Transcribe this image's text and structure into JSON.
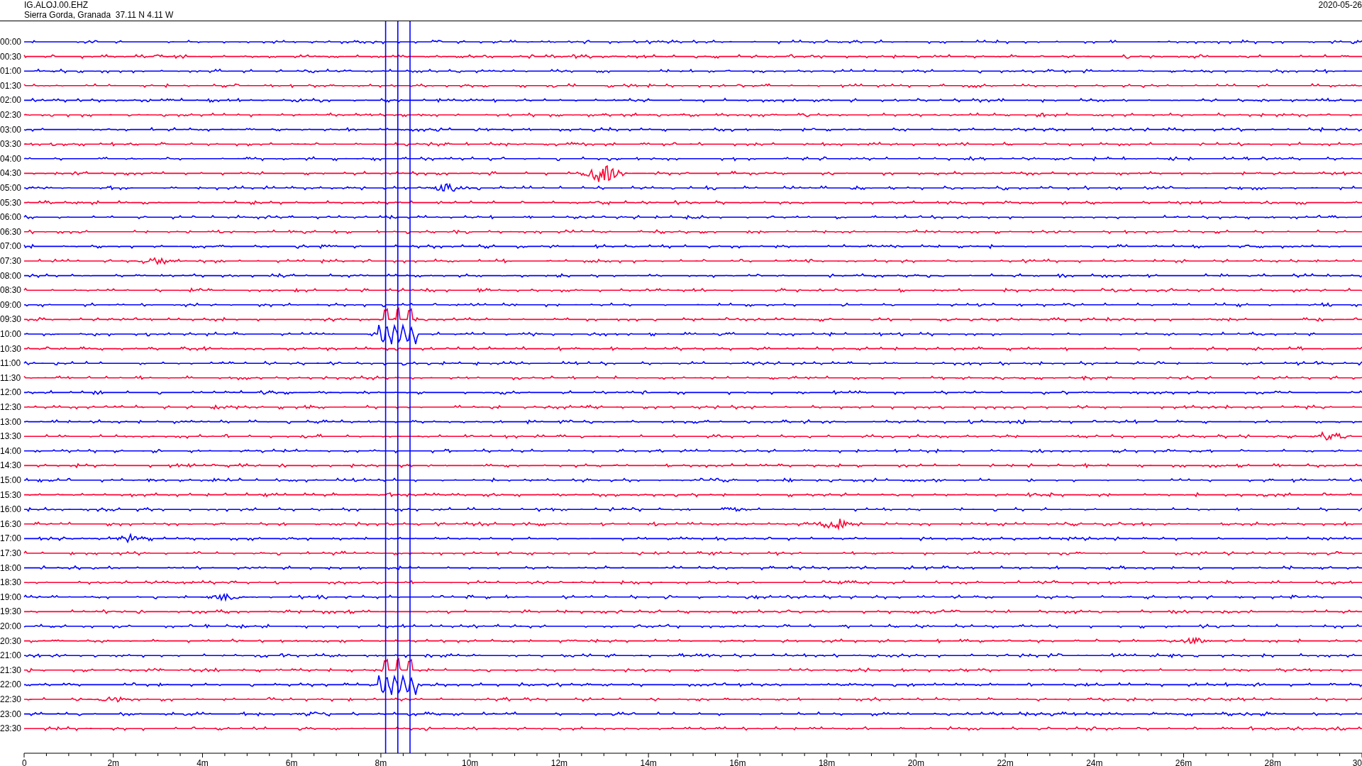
{
  "header": {
    "station": "IG.ALOJ.00.EHZ",
    "location": "Sierra Gorda, Granada  37.11 N 4.11 W",
    "date": "2020-05-26"
  },
  "traces": [
    {
      "label": "00:00",
      "color": "#0000ff"
    },
    {
      "label": "00:30",
      "color": "#ff0033"
    },
    {
      "label": "01:00",
      "color": "#0000ff"
    },
    {
      "label": "01:30",
      "color": "#ff0033"
    },
    {
      "label": "02:00",
      "color": "#0000ff"
    },
    {
      "label": "02:30",
      "color": "#ff0033"
    },
    {
      "label": "03:00",
      "color": "#0000ff"
    },
    {
      "label": "03:30",
      "color": "#ff0033"
    },
    {
      "label": "04:00",
      "color": "#0000ff"
    },
    {
      "label": "04:30",
      "color": "#ff0033"
    },
    {
      "label": "05:00",
      "color": "#0000ff"
    },
    {
      "label": "05:30",
      "color": "#ff0033"
    },
    {
      "label": "06:00",
      "color": "#0000ff"
    },
    {
      "label": "06:30",
      "color": "#ff0033"
    },
    {
      "label": "07:00",
      "color": "#0000ff"
    },
    {
      "label": "07:30",
      "color": "#ff0033"
    },
    {
      "label": "08:00",
      "color": "#0000ff"
    },
    {
      "label": "08:30",
      "color": "#ff0033"
    },
    {
      "label": "09:00",
      "color": "#0000ff"
    },
    {
      "label": "09:30",
      "color": "#ff0033"
    },
    {
      "label": "10:00",
      "color": "#0000ff"
    },
    {
      "label": "10:30",
      "color": "#ff0033"
    },
    {
      "label": "11:00",
      "color": "#0000ff"
    },
    {
      "label": "11:30",
      "color": "#ff0033"
    },
    {
      "label": "12:00",
      "color": "#0000ff"
    },
    {
      "label": "12:30",
      "color": "#ff0033"
    },
    {
      "label": "13:00",
      "color": "#0000ff"
    },
    {
      "label": "13:30",
      "color": "#ff0033"
    },
    {
      "label": "14:00",
      "color": "#0000ff"
    },
    {
      "label": "14:30",
      "color": "#ff0033"
    },
    {
      "label": "15:00",
      "color": "#0000ff"
    },
    {
      "label": "15:30",
      "color": "#ff0033"
    },
    {
      "label": "16:00",
      "color": "#0000ff"
    },
    {
      "label": "16:30",
      "color": "#ff0033"
    },
    {
      "label": "17:00",
      "color": "#0000ff"
    },
    {
      "label": "17:30",
      "color": "#ff0033"
    },
    {
      "label": "18:00",
      "color": "#0000ff"
    },
    {
      "label": "18:30",
      "color": "#ff0033"
    },
    {
      "label": "19:00",
      "color": "#0000ff"
    },
    {
      "label": "19:30",
      "color": "#ff0033"
    },
    {
      "label": "20:00",
      "color": "#0000ff"
    },
    {
      "label": "20:30",
      "color": "#ff0033"
    },
    {
      "label": "21:00",
      "color": "#0000ff"
    },
    {
      "label": "21:30",
      "color": "#ff0033"
    },
    {
      "label": "22:00",
      "color": "#0000ff"
    },
    {
      "label": "22:30",
      "color": "#ff0033"
    },
    {
      "label": "23:00",
      "color": "#0000ff"
    },
    {
      "label": "23:30",
      "color": "#ff0033"
    }
  ],
  "x_axis": {
    "ticks": [
      "0",
      "2m",
      "4m",
      "6m",
      "8m",
      "10m",
      "12m",
      "14m",
      "16m",
      "18m",
      "20m",
      "22m",
      "24m",
      "26m",
      "28m",
      "30"
    ]
  }
}
